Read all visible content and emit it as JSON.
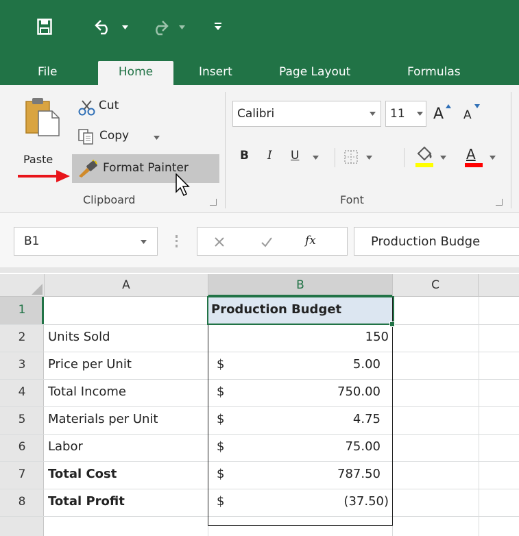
{
  "quick_access": {
    "save_icon": "save-icon",
    "undo_icon": "undo-icon",
    "redo_icon": "redo-icon",
    "customize_icon": "customize-qat-icon"
  },
  "tabs": [
    {
      "label": "File"
    },
    {
      "label": "Home",
      "active": true
    },
    {
      "label": "Insert"
    },
    {
      "label": "Page Layout"
    },
    {
      "label": "Formulas"
    }
  ],
  "clipboard": {
    "paste_label": "Paste",
    "cut_label": "Cut",
    "copy_label": "Copy",
    "format_painter_label": "Format Painter",
    "group_label": "Clipboard"
  },
  "font": {
    "font_name": "Calibri",
    "font_size": "11",
    "bold_label": "B",
    "italic_label": "I",
    "underline_label": "U",
    "grow_label": "A",
    "shrink_label": "A",
    "highlight_color": "#ffff00",
    "font_color_label": "A",
    "font_color": "#ff0000",
    "group_label": "Font"
  },
  "formula_bar": {
    "name_box": "B1",
    "fx_label": "fx",
    "content": "Production Budge"
  },
  "columns": [
    "A",
    "B",
    "C"
  ],
  "rows": [
    {
      "num": "1",
      "a": "",
      "b_sym": "",
      "b_val": "Production Budget"
    },
    {
      "num": "2",
      "a": "Units Sold",
      "b_sym": "",
      "b_val": "150"
    },
    {
      "num": "3",
      "a": "Price per Unit",
      "b_sym": "$",
      "b_val": "5.00"
    },
    {
      "num": "4",
      "a": "Total Income",
      "b_sym": "$",
      "b_val": "750.00"
    },
    {
      "num": "5",
      "a": "Materials per Unit",
      "b_sym": "$",
      "b_val": "4.75"
    },
    {
      "num": "6",
      "a": "Labor",
      "b_sym": "$",
      "b_val": "75.00"
    },
    {
      "num": "7",
      "a": "Total Cost",
      "b_sym": "$",
      "b_val": "787.50"
    },
    {
      "num": "8",
      "a": "Total Profit",
      "b_sym": "$",
      "b_val": "(37.50)"
    }
  ],
  "colors": {
    "accent": "#217346",
    "selection": "#217346",
    "cell_fill": "#dce6f1",
    "arrow": "#e8141a"
  }
}
